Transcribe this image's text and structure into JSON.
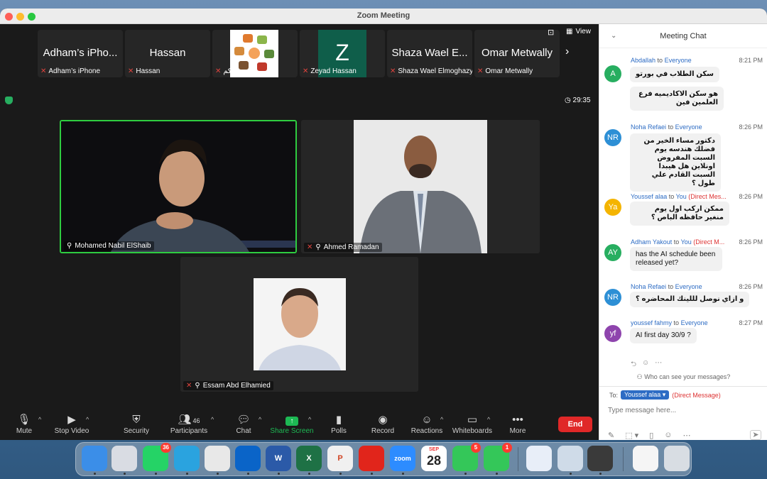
{
  "window": {
    "title": "Zoom Meeting"
  },
  "top_strip": {
    "tiles": [
      {
        "big_name": "Adham’s iPho...",
        "label": "Adham’s iPhone"
      },
      {
        "big_name": "Hassan",
        "label": "Hassan"
      },
      {
        "big_name": "",
        "label": "منصة خيركم"
      },
      {
        "big_name": "Z",
        "label": "Zeyad Hassan"
      },
      {
        "big_name": "Shaza Wael E...",
        "label": "Shaza Wael Elmoghazy"
      },
      {
        "big_name": "Omar Metwally",
        "label": "Omar Metwally"
      }
    ],
    "view_label": "View"
  },
  "timer": "29:35",
  "videos": [
    {
      "name": "Mohamed Nabil ElShaib"
    },
    {
      "name": "Ahmed Ramadan"
    },
    {
      "name": "Essam Abd Elhamied"
    }
  ],
  "toolbar": {
    "mute": "Mute",
    "stop_video": "Stop Video",
    "security": "Security",
    "participants": "Participants",
    "participants_count": "46",
    "chat": "Chat",
    "share_screen": "Share Screen",
    "polls": "Polls",
    "record": "Record",
    "reactions": "Reactions",
    "whiteboards": "Whiteboards",
    "more": "More",
    "end": "End"
  },
  "chat": {
    "title": "Meeting Chat",
    "messages": [
      {
        "initials": "A",
        "color": "#27ae60",
        "sender": "Abdallah",
        "to_word": "to",
        "recipient": "Everyone",
        "dm": "",
        "time": "8:21 PM",
        "bubbles": [
          "سكن الطلاب في بورتو",
          "هو سكن الاكاديميه فرع العلمين فين"
        ]
      },
      {
        "initials": "NR",
        "color": "#2d8fd5",
        "sender": "Noha Refaei",
        "to_word": "to",
        "recipient": "Everyone",
        "dm": "",
        "time": "8:26 PM",
        "bubbles": [
          "دكتور مساء الخير من فضلك هندسه يوم السبت المفروض اونلاين هل هيبدا السبت القادم علي طول ؟"
        ]
      },
      {
        "initials": "Ya",
        "color": "#f4b400",
        "sender": "Youssef alaa",
        "to_word": "to",
        "recipient": "You",
        "dm": "(Direct Mes...",
        "time": "8:26 PM",
        "bubbles": [
          "ممكن اركب اول يوم منغير حافظه الباص ؟"
        ]
      },
      {
        "initials": "AY",
        "color": "#27ae60",
        "sender": "Adham Yakout",
        "to_word": "to",
        "recipient": "You",
        "dm": "(Direct M...",
        "time": "8:26 PM",
        "bubbles": [
          "has the AI schedule been released yet?"
        ]
      },
      {
        "initials": "NR",
        "color": "#2d8fd5",
        "sender": "Noha Refaei",
        "to_word": "to",
        "recipient": "Everyone",
        "dm": "",
        "time": "8:26 PM",
        "bubbles": [
          "و ازاي نوصل لللينك المحاضره ؟"
        ]
      },
      {
        "initials": "yf",
        "color": "#8e44ad",
        "sender": "youssef fahmy",
        "to_word": "to",
        "recipient": "Everyone",
        "dm": "",
        "time": "8:27 PM",
        "bubbles": [
          "AI first day 30/9 ?"
        ]
      }
    ],
    "who_can_see": "Who can see your messages?",
    "to_label": "To:",
    "to_recipient": "Youssef alaa",
    "to_dm": "(Direct Message)",
    "input_placeholder": "Type message here..."
  },
  "dock": {
    "apps": [
      {
        "name": "finder-app",
        "label": "",
        "color": "#3b8ee8",
        "badge": ""
      },
      {
        "name": "launchpad-app",
        "label": "",
        "color": "#d9dce3",
        "badge": ""
      },
      {
        "name": "whatsapp-app",
        "label": "",
        "color": "#25d366",
        "badge": "36"
      },
      {
        "name": "telegram-app",
        "label": "",
        "color": "#2aa3df",
        "badge": ""
      },
      {
        "name": "chrome-app",
        "label": "",
        "color": "#e8e8e8",
        "badge": ""
      },
      {
        "name": "outlook-app",
        "label": "",
        "color": "#0a64c8",
        "badge": ""
      },
      {
        "name": "word-app",
        "label": "W",
        "color": "#2b5aa8",
        "badge": ""
      },
      {
        "name": "excel-app",
        "label": "X",
        "color": "#1e7145",
        "badge": ""
      },
      {
        "name": "powerpoint-app",
        "label": "P",
        "color": "#f0f0f0",
        "badge": ""
      },
      {
        "name": "acrobat-app",
        "label": "",
        "color": "#e1251b",
        "badge": ""
      },
      {
        "name": "zoom-app",
        "label": "zoom",
        "color": "#2d8cff",
        "badge": ""
      },
      {
        "name": "calendar-app",
        "label": "28",
        "color": "#ffffff",
        "badge": ""
      },
      {
        "name": "messages-app",
        "label": "",
        "color": "#34c759",
        "badge": "5"
      },
      {
        "name": "facetime-app",
        "label": "",
        "color": "#34c759",
        "badge": "1"
      },
      {
        "name": "appstore-app",
        "label": "",
        "color": "#e8eef8",
        "badge": ""
      },
      {
        "name": "preview-app",
        "label": "",
        "color": "#cfdbe8",
        "badge": ""
      },
      {
        "name": "calculator-app",
        "label": "",
        "color": "#3a3a3a",
        "badge": ""
      },
      {
        "name": "document-app",
        "label": "",
        "color": "#f5f5f5",
        "badge": ""
      },
      {
        "name": "trash-app",
        "label": "",
        "color": "#d8dde3",
        "badge": ""
      }
    ],
    "calendar_month": "SEP"
  }
}
